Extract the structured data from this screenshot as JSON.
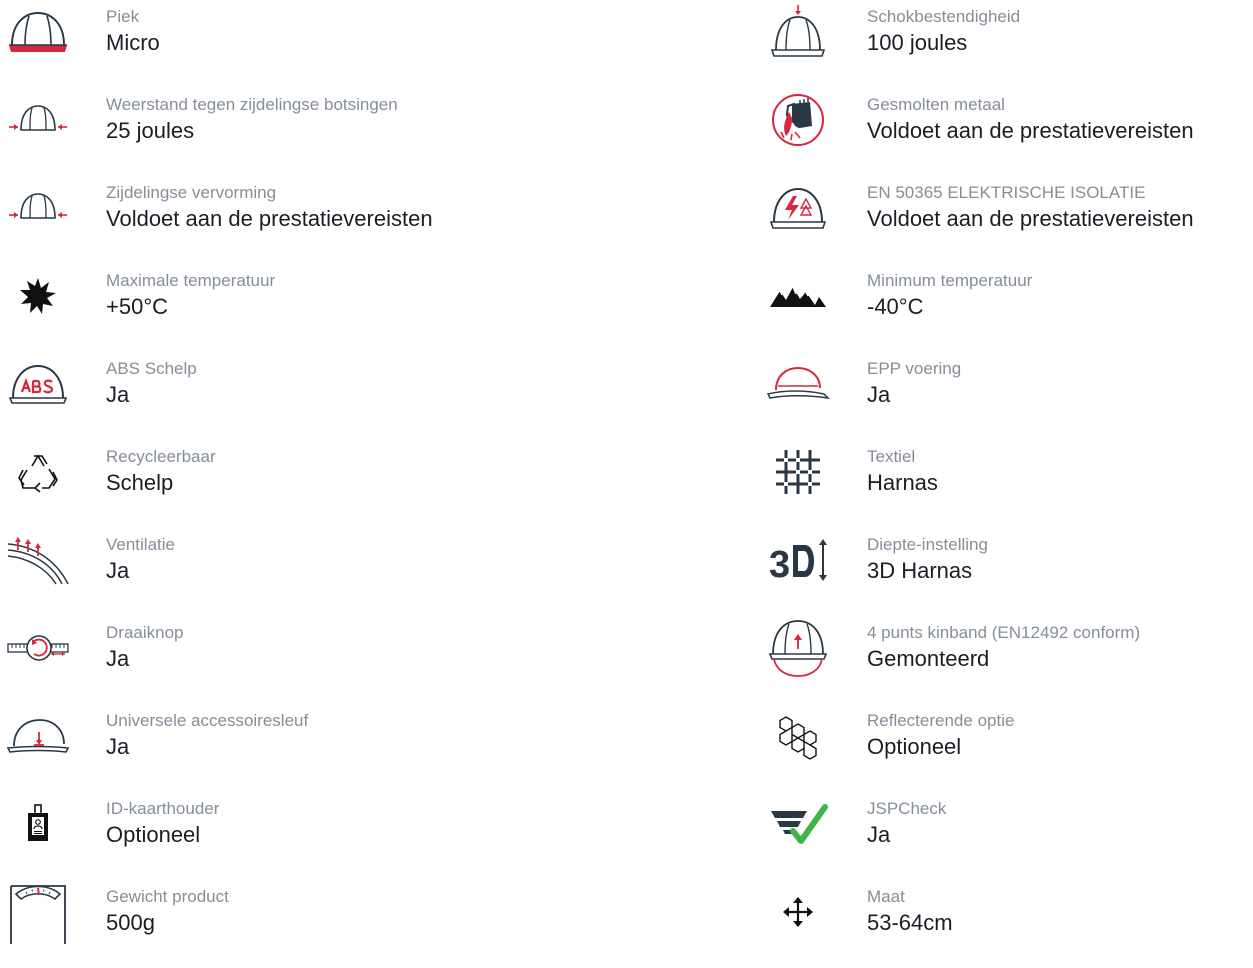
{
  "colors": {
    "label": "#858e99",
    "value": "#1a1f26",
    "icon_stroke": "#2a3745",
    "accent": "#d7263d",
    "check": "#3fb449"
  },
  "left": [
    {
      "icon": "helmet-peak-icon",
      "label": "Piek",
      "value": "Micro"
    },
    {
      "icon": "side-impact-icon",
      "label": "Weerstand tegen zijdelingse botsingen",
      "value": "25 joules"
    },
    {
      "icon": "lateral-deformation-icon",
      "label": "Zijdelingse vervorming",
      "value": "Voldoet aan de prestatievereisten"
    },
    {
      "icon": "sun-icon",
      "label": "Maximale temperatuur",
      "value": "+50°C"
    },
    {
      "icon": "abs-shell-icon",
      "label": "ABS Schelp",
      "value": "Ja"
    },
    {
      "icon": "recycle-icon",
      "label": "Recycleerbaar",
      "value": "Schelp"
    },
    {
      "icon": "ventilation-icon",
      "label": "Ventilatie",
      "value": "Ja"
    },
    {
      "icon": "rotary-knob-icon",
      "label": "Draaiknop",
      "value": "Ja"
    },
    {
      "icon": "accessory-slot-icon",
      "label": "Universele accessoiresleuf",
      "value": "Ja"
    },
    {
      "icon": "id-card-holder-icon",
      "label": "ID-kaarthouder",
      "value": "Optioneel"
    },
    {
      "icon": "weight-scale-icon",
      "label": "Gewicht product",
      "value": "500g"
    }
  ],
  "right": [
    {
      "icon": "shock-resistance-icon",
      "label": "Schokbestendigheid",
      "value": "100 joules"
    },
    {
      "icon": "molten-metal-icon",
      "label": "Gesmolten metaal",
      "value": "Voldoet aan de prestatievereisten"
    },
    {
      "icon": "electrical-insulation-icon",
      "label": "EN 50365 ELEKTRISCHE ISOLATIE",
      "value": "Voldoet aan de prestatievereisten"
    },
    {
      "icon": "mountains-icon",
      "label": "Minimum temperatuur",
      "value": "-40°C"
    },
    {
      "icon": "epp-liner-icon",
      "label": "EPP voering",
      "value": "Ja"
    },
    {
      "icon": "textile-icon",
      "label": "Textiel",
      "value": "Harnas"
    },
    {
      "icon": "depth-3d-icon",
      "label": "Diepte-instelling",
      "value": "3D Harnas"
    },
    {
      "icon": "chinstrap-icon",
      "label": "4 punts kinband (EN12492 conform)",
      "value": "Gemonteerd"
    },
    {
      "icon": "reflective-icon",
      "label": "Reflecterende optie",
      "value": "Optioneel"
    },
    {
      "icon": "jspcheck-icon",
      "label": "JSPCheck",
      "value": "Ja"
    },
    {
      "icon": "size-move-icon",
      "label": "Maat",
      "value": "53-64cm"
    }
  ]
}
